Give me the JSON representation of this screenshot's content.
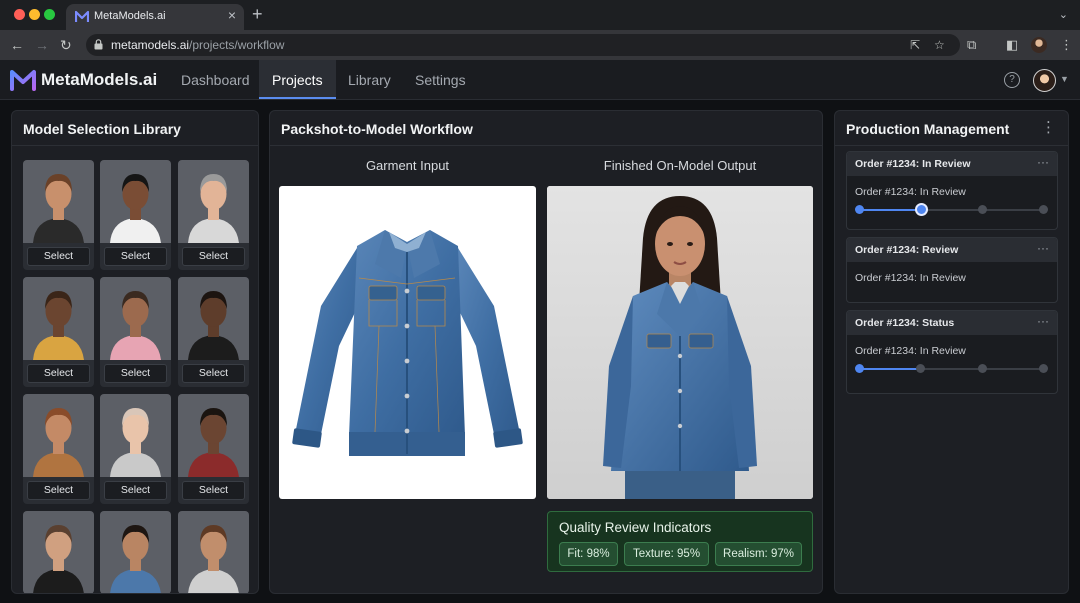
{
  "browser": {
    "tab_title": "MetaModels.ai",
    "url_host": "metamodels.ai",
    "url_path": "/projects/workflow"
  },
  "app": {
    "brand": "MetaModels.ai",
    "nav": [
      "Dashboard",
      "Projects",
      "Library",
      "Settings"
    ],
    "active_nav": "Projects"
  },
  "library": {
    "title": "Model Selection Library",
    "select_label": "Select"
  },
  "workflow": {
    "title": "Packshot-to-Model Workflow",
    "input_label": "Garment Input",
    "output_label": "Finished On-Model Output",
    "quality": {
      "title": "Quality Review Indicators",
      "chips": [
        "Fit: 98%",
        "Texture: 95%",
        "Realism: 97%"
      ]
    }
  },
  "production": {
    "title": "Production Management",
    "orders": [
      {
        "header": "Order #1234: In Review",
        "status": "Order #1234: In Review",
        "progress": 0.33,
        "has_track": true
      },
      {
        "header": "Order #1234: Review",
        "status": "Order #1234: In Review",
        "has_track": false
      },
      {
        "header": "Order #1234: Status",
        "status": "Order #1234: In Review",
        "progress": 0.3,
        "has_track": true
      }
    ]
  },
  "colors": {
    "accent": "#4f86f0",
    "quality_bg": "#17341f",
    "panel_bg": "#1d1f24"
  }
}
